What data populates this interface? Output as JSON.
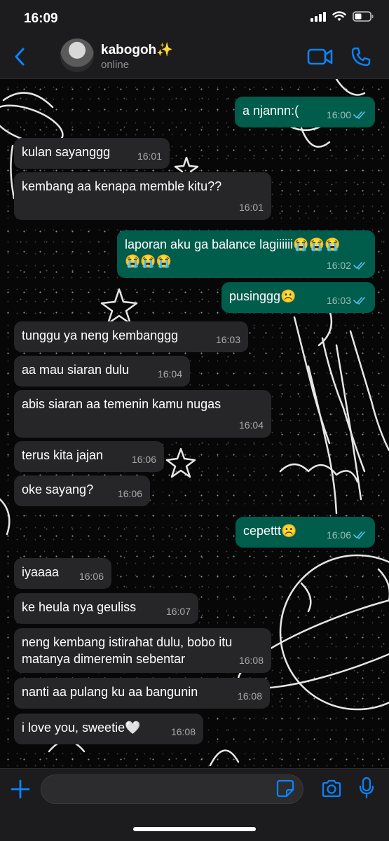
{
  "status_bar": {
    "time": "16:09"
  },
  "header": {
    "contact_name": "kabogoh✨",
    "contact_status": "online"
  },
  "colors": {
    "accent": "#0a84ff",
    "outgoing_bubble": "#005c4b",
    "incoming_bubble": "#262628",
    "read_ticks": "#53bdeb"
  },
  "messages": [
    {
      "text": "a njannn:(",
      "time": "16:00",
      "dir": "out",
      "read": true
    },
    {
      "text": "kulan sayanggg",
      "time": "16:01",
      "dir": "in"
    },
    {
      "text": "kembang aa kenapa memble kitu??",
      "time": "16:01",
      "dir": "in"
    },
    {
      "text": "laporan aku ga balance lagiiiiii😭😭😭",
      "text2": "😭😭😭",
      "time": "16:02",
      "dir": "out",
      "read": true
    },
    {
      "text": "pusinggg☹️",
      "time": "16:03",
      "dir": "out",
      "read": true
    },
    {
      "text": "tunggu ya neng kembanggg",
      "time": "16:03",
      "dir": "in"
    },
    {
      "text": "aa mau siaran dulu",
      "time": "16:04",
      "dir": "in"
    },
    {
      "text": "abis siaran aa temenin kamu nugas",
      "time": "16:04",
      "dir": "in"
    },
    {
      "text": "terus kita jajan",
      "time": "16:06",
      "dir": "in"
    },
    {
      "text": "oke sayang?",
      "time": "16:06",
      "dir": "in"
    },
    {
      "text": "cepettt☹️",
      "time": "16:06",
      "dir": "out",
      "read": true
    },
    {
      "text": "iyaaaa",
      "time": "16:06",
      "dir": "in"
    },
    {
      "text": "ke heula nya geuliss",
      "time": "16:07",
      "dir": "in"
    },
    {
      "text": "neng kembang istirahat dulu, bobo itu",
      "text2": "matanya dimeremin sebentar",
      "time": "16:08",
      "dir": "in"
    },
    {
      "text": "nanti aa pulang ku aa bangunin",
      "time": "16:08",
      "dir": "in"
    },
    {
      "text": "i love you, sweetie🤍",
      "time": "16:08",
      "dir": "in"
    }
  ],
  "composer": {
    "value": "",
    "placeholder": ""
  }
}
